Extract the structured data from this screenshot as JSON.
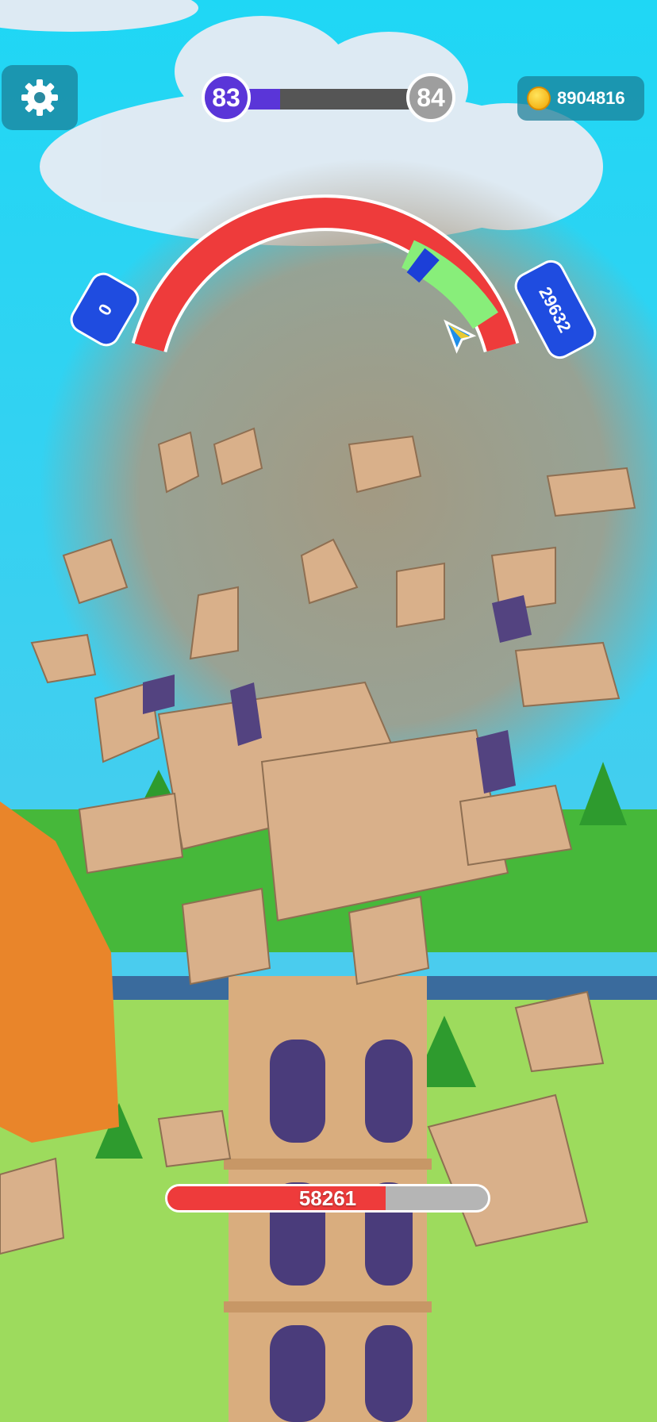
{
  "level": {
    "current": "83",
    "next": "84",
    "progress": 0.24,
    "fill_color": "#5a35d8"
  },
  "coins": {
    "amount": "8904816"
  },
  "gauge": {
    "min_label": "0",
    "max_label": "29632",
    "needle_position": 0.93
  },
  "tower": {
    "health": "58261",
    "health_fraction": 0.68
  },
  "icons": {
    "settings": "gear-icon",
    "coin": "coin-icon",
    "needle": "arrow-pointer-icon"
  },
  "colors": {
    "danger": "#ee3b3b",
    "good": "#88ee7a",
    "perfect": "#1c3fd8",
    "bubble": "#1f4ce0"
  }
}
